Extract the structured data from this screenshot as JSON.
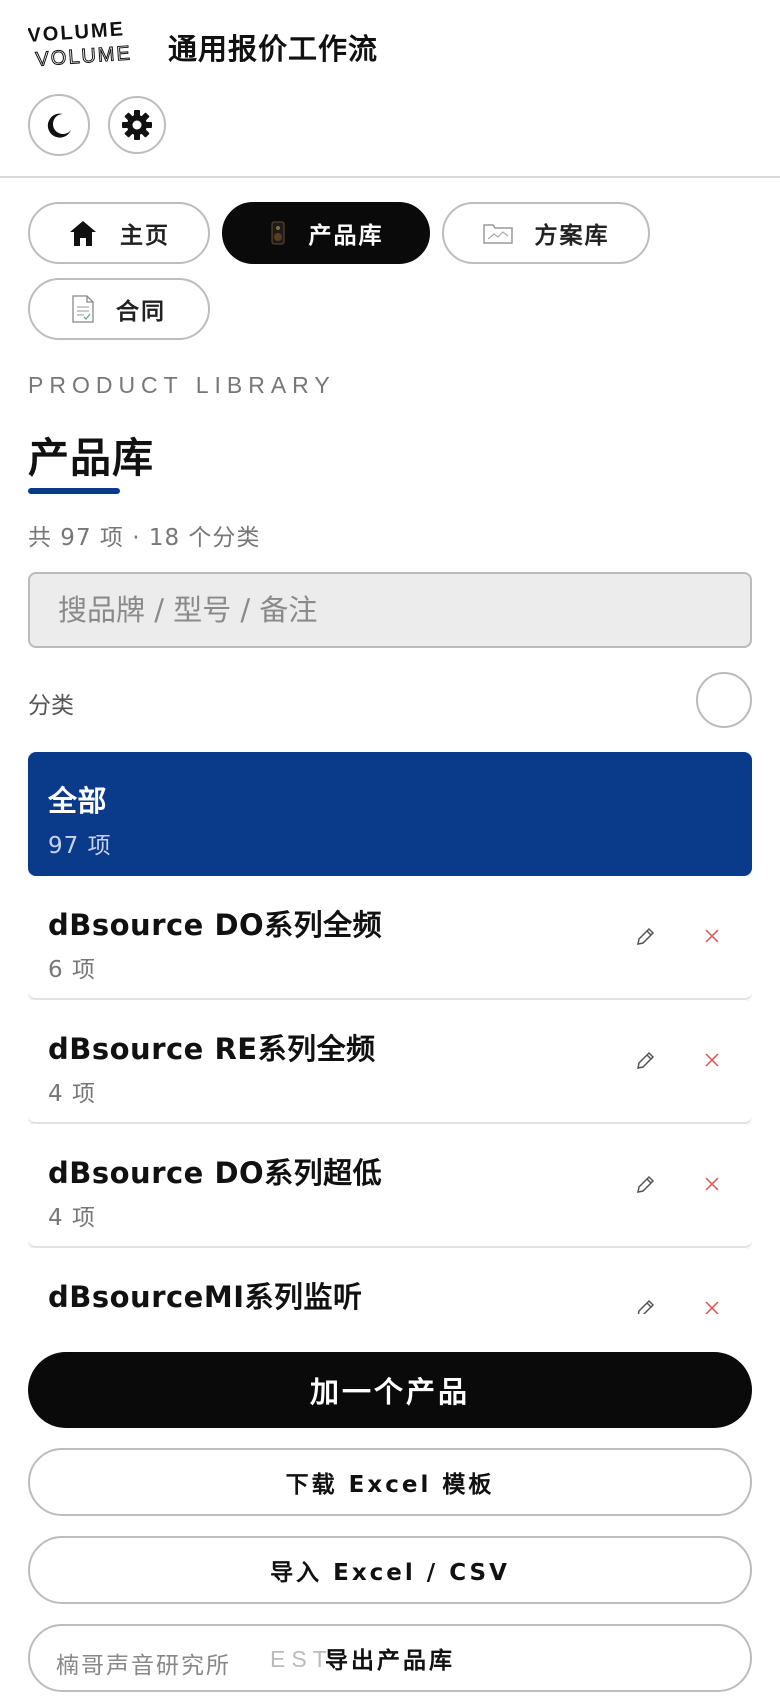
{
  "header": {
    "logo_text_top": "VOLUME",
    "logo_text_bottom": "VOLUME",
    "app_title": "通用报价工作流",
    "theme_toggle_icon": "moon-icon",
    "settings_icon": "gear-icon"
  },
  "nav": {
    "tabs": [
      {
        "label": "主页",
        "icon": "home-icon",
        "active": false
      },
      {
        "label": "产品库",
        "icon": "speaker-icon",
        "active": true
      },
      {
        "label": "方案库",
        "icon": "folder-icon",
        "active": false
      },
      {
        "label": "合同",
        "icon": "contract-document-icon",
        "active": false
      }
    ]
  },
  "page": {
    "eyebrow": "PRODUCT LIBRARY",
    "title": "产品库",
    "summary": "共 97 项 · 18 个分类",
    "accent_color": "#0a3a8a"
  },
  "search": {
    "placeholder": "搜品牌 / 型号 / 备注",
    "value": ""
  },
  "filter": {
    "label": "分类"
  },
  "categories": [
    {
      "name": "全部",
      "count": "97 项",
      "selected": true
    },
    {
      "name": "dBsource DO系列全频",
      "count": "6 项",
      "selected": false
    },
    {
      "name": "dBsource RE系列全频",
      "count": "4 项",
      "selected": false
    },
    {
      "name": "dBsource DO系列超低",
      "count": "4 项",
      "selected": false
    },
    {
      "name": "dBsourceMI系列监听",
      "count": "",
      "selected": false
    }
  ],
  "actions": {
    "add_product": "加一个产品",
    "download_template": "下载 Excel 模板",
    "import": "导入 Excel / CSV",
    "export": "导出产品库"
  },
  "footer": {
    "credit": "楠哥声音研究所",
    "est": "EST"
  }
}
